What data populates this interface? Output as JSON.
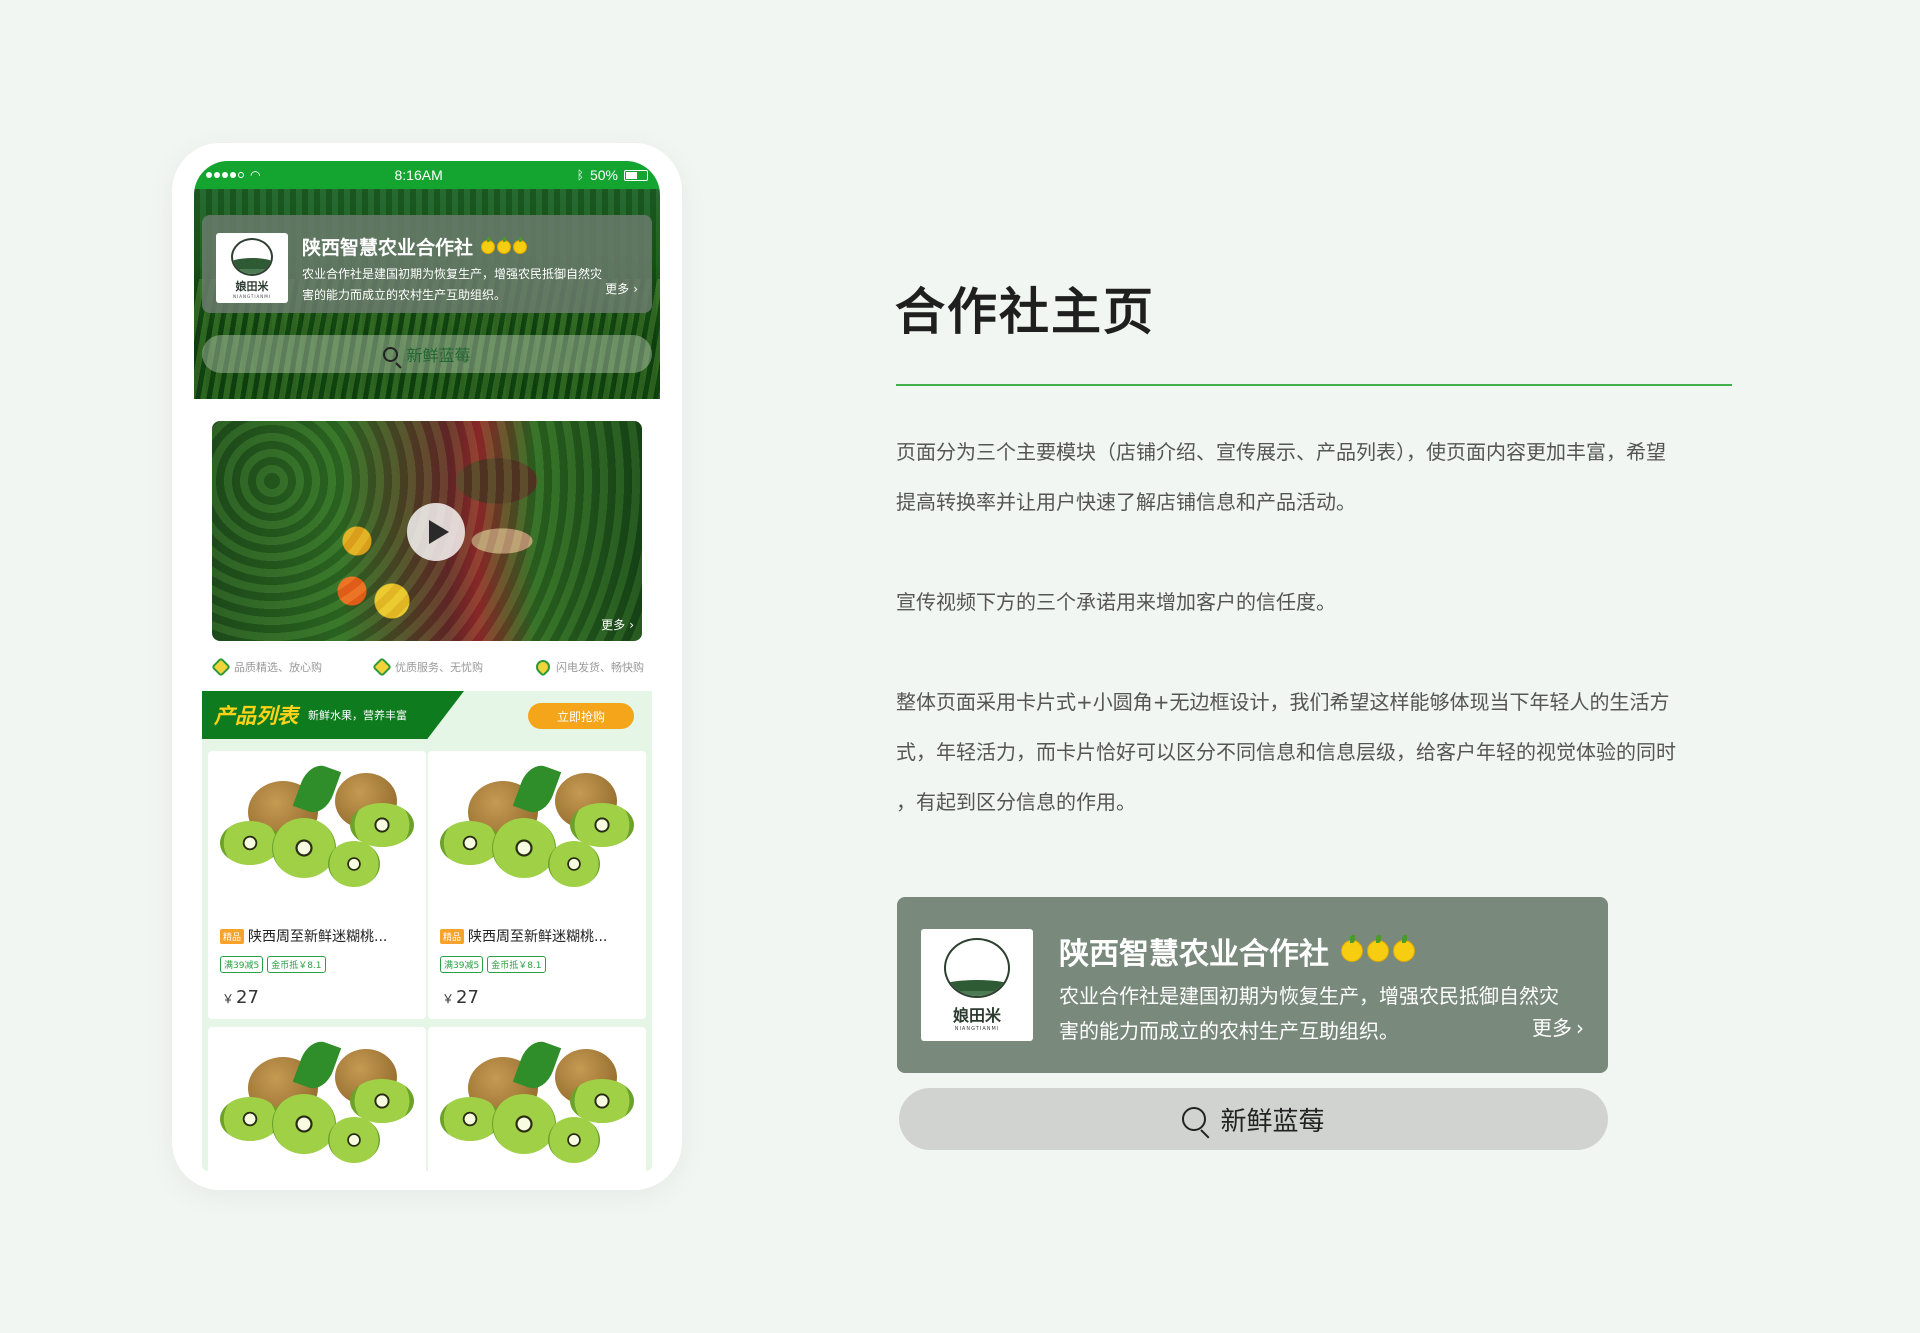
{
  "status_bar": {
    "time": "8:16AM",
    "battery": "50%"
  },
  "cooperative": {
    "title": "陕西智慧农业合作社",
    "description_line1": "农业合作社是建国初期为恢复生产，增强农民抵御自然灾",
    "description_line2": "害的能力而成立的农村生产互助组织。",
    "more_label": "更多",
    "logo_text": "娘田米",
    "logo_subtext": "NIANGTIANMI"
  },
  "search": {
    "placeholder": "新鲜蓝莓"
  },
  "video": {
    "more_label": "更多"
  },
  "promises": [
    {
      "label": "品质精选、放心购",
      "icon": "heart-badge-icon"
    },
    {
      "label": "优质服务、无忧购",
      "icon": "tag-badge-icon"
    },
    {
      "label": "闪电发货、畅快购",
      "icon": "rocket-badge-icon"
    }
  ],
  "product_section": {
    "title": "产品列表",
    "subtitle": "新鲜水果，营养丰富",
    "buy_button": "立即抢购"
  },
  "products": [
    {
      "badge": "精品",
      "name": "陕西周至新鲜迷糊桃...",
      "coupon1": "满39减5",
      "coupon2": "金币抵￥8.1",
      "currency": "￥",
      "price": "27"
    },
    {
      "badge": "精品",
      "name": "陕西周至新鲜迷糊桃...",
      "coupon1": "满39减5",
      "coupon2": "金币抵￥8.1",
      "currency": "￥",
      "price": "27"
    },
    {
      "badge": "",
      "name": "",
      "coupon1": "",
      "coupon2": "",
      "currency": "",
      "price": ""
    },
    {
      "badge": "",
      "name": "",
      "coupon1": "",
      "coupon2": "",
      "currency": "",
      "price": ""
    }
  ],
  "description": {
    "heading": "合作社主页",
    "paragraph1_line1": "页面分为三个主要模块（店铺介绍、宣传展示、产品列表），使页面内容更加丰富，希望",
    "paragraph1_line2": "提高转换率并让用户快速了解店铺信息和产品活动。",
    "paragraph2": "宣传视频下方的三个承诺用来增加客户的信任度。",
    "paragraph3_line1": "整体页面采用卡片式+小圆角+无边框设计，我们希望这样能够体现当下年轻人的生活方",
    "paragraph3_line2": "式，年轻活力，而卡片恰好可以区分不同信息和信息层级，给客户年轻的视觉体验的同时",
    "paragraph3_line3": "，有起到区分信息的作用。"
  },
  "colors": {
    "brand_green": "#13a530",
    "dark_green": "#0e7c1e",
    "accent_yellow": "#ffd21a",
    "buy_orange": "#f5a51a",
    "rule_green": "#43b04e"
  }
}
